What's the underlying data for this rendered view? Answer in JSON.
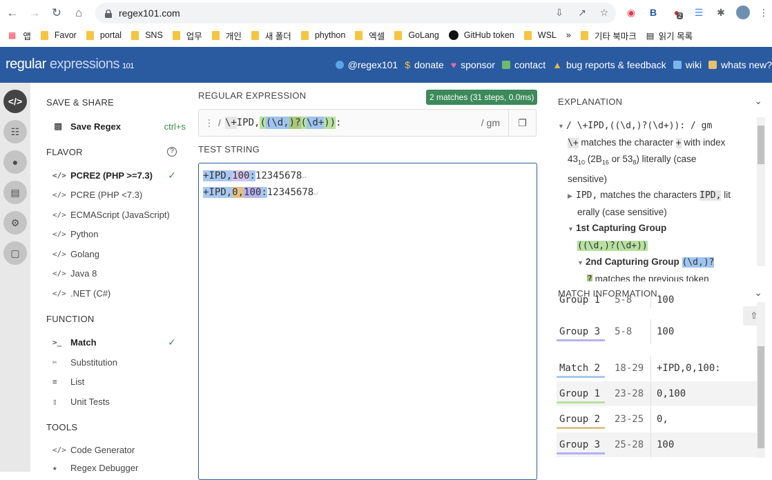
{
  "browser": {
    "url": "regex101.com",
    "bookmarks": [
      "앱",
      "Favor",
      "portal",
      "SNS",
      "업무",
      "개인",
      "새 폴더",
      "phython",
      "엑셀",
      "GoLang",
      "GitHub token",
      "WSL",
      "»",
      "기타 북마크",
      "읽기 목록"
    ],
    "ext_badge": "2"
  },
  "header": {
    "logo_main": "regular",
    "logo_light": " expressions",
    "logo_version": "101",
    "links": [
      "@regex101",
      "donate",
      "sponsor",
      "contact",
      "bug reports & feedback",
      "wiki",
      "whats new?"
    ]
  },
  "left": {
    "save_share": "SAVE & SHARE",
    "save_regex": "Save Regex",
    "save_shortcut": "ctrl+s",
    "flavor": "FLAVOR",
    "flavors": [
      "PCRE2 (PHP >=7.3)",
      "PCRE (PHP <7.3)",
      "ECMAScript (JavaScript)",
      "Python",
      "Golang",
      "Java 8",
      ".NET (C#)"
    ],
    "function": "FUNCTION",
    "functions": [
      "Match",
      "Substitution",
      "List",
      "Unit Tests"
    ],
    "tools": "TOOLS",
    "tool_items": [
      "Code Generator",
      "Regex Debugger"
    ]
  },
  "middle": {
    "regex_label": "REGULAR EXPRESSION",
    "match_badge": "2 matches (31 steps, 0.0ms)",
    "delim_open": "/",
    "flags": "/ gm",
    "regex_tokens": [
      "\\+",
      "IPD,",
      "(",
      "(",
      "\\d",
      ",",
      ")?",
      "(",
      "\\d+",
      ")",
      ")",
      ":"
    ],
    "test_label": "TEST STRING",
    "test_lines": [
      [
        "+",
        "IPD,",
        "100",
        ":",
        "12345678"
      ],
      [
        "+IPD,",
        "0,",
        "100",
        ":",
        "12345678"
      ]
    ]
  },
  "explanation": {
    "title": "EXPLANATION",
    "regex_line": "/ \\+IPD,((\\d,)?(\\d+)): / gm",
    "line1_a": "\\+",
    "line1_b": " matches the character ",
    "line1_c": "+",
    "line1_d": " with index",
    "line2_a": "43",
    "line2_b": "10",
    "line2_c": " (2B",
    "line2_d": "16",
    "line2_e": " or 53",
    "line2_f": "8",
    "line2_g": ") literally (case",
    "line3": "sensitive)",
    "ipd_a": "IPD,",
    "ipd_b": " matches the characters ",
    "ipd_c": "IPD,",
    "ipd_d": " lit",
    "ipd_e": "erally (case sensitive)",
    "group1": "1st Capturing Group",
    "group1_expr": "((\\d,)?(\\d+))",
    "group2": "2nd Capturing Group",
    "group2_expr": "(\\d,)?",
    "q_a": "?",
    "q_b": " matches the previous token"
  },
  "match_info": {
    "title": "MATCH INFORMATION",
    "rows": [
      {
        "name": "Group 1",
        "range": "5-8",
        "value": "100",
        "color": "#b7e1a0"
      },
      {
        "name": "Group 3",
        "range": "5-8",
        "value": "100",
        "color": "#b6b1f2"
      },
      {
        "name": "Match 2",
        "range": "18-29",
        "value": "+IPD,0,100:",
        "color": "#a7c8f0"
      },
      {
        "name": "Group 1",
        "range": "23-28",
        "value": "0,100",
        "color": "#b7e1a0"
      },
      {
        "name": "Group 2",
        "range": "23-25",
        "value": "0,",
        "color": "#e2c08a"
      },
      {
        "name": "Group 3",
        "range": "25-28",
        "value": "100",
        "color": "#b6b1f2"
      }
    ]
  }
}
